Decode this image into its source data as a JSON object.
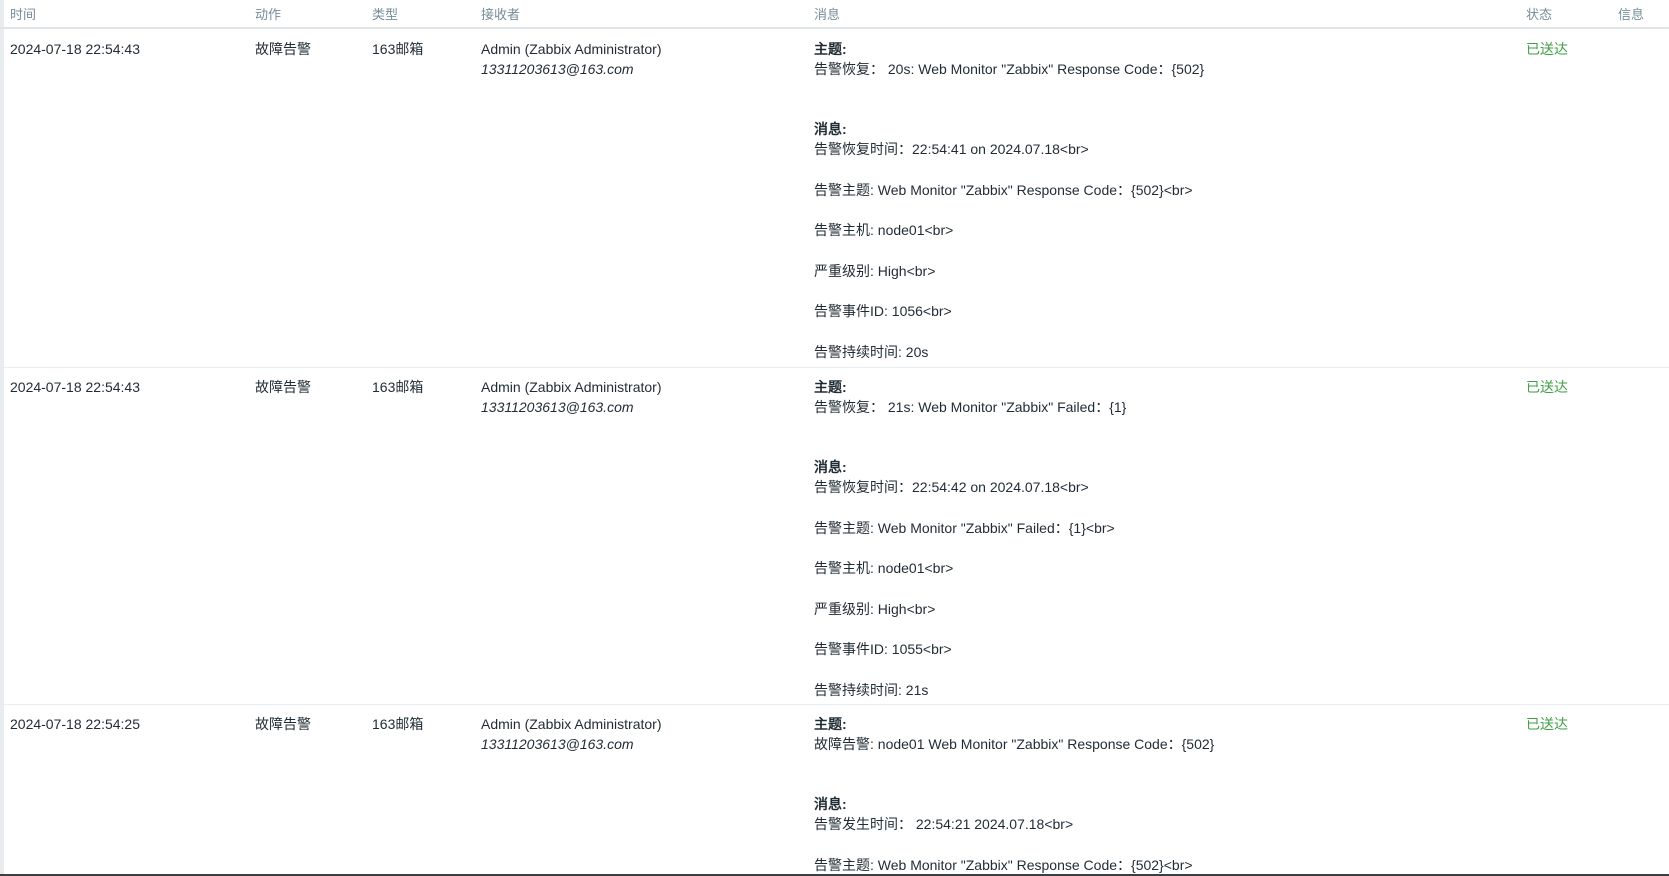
{
  "columns": {
    "time": "时间",
    "action": "动作",
    "type": "类型",
    "recipient": "接收者",
    "message": "消息",
    "status": "状态",
    "info": "信息"
  },
  "rows": [
    {
      "time": "2024-07-18 22:54:43",
      "action": "故障告警",
      "type": "163邮箱",
      "recipient_name": "Admin (Zabbix Administrator)",
      "recipient_email": "13311203613@163.com",
      "subject_heading": "主题:",
      "subject": "告警恢复： 20s: Web Monitor \"Zabbix\" Response Code：{502}",
      "message_heading": "消息:",
      "lines": [
        "告警恢复时间：22:54:41 on 2024.07.18<br>",
        "告警主题: Web Monitor \"Zabbix\" Response Code：{502}<br>",
        "告警主机: node01<br>",
        "严重级别: High<br>",
        "告警事件ID: 1056<br>",
        "告警持续时间: 20s"
      ],
      "status": "已送达"
    },
    {
      "time": "2024-07-18 22:54:43",
      "action": "故障告警",
      "type": "163邮箱",
      "recipient_name": "Admin (Zabbix Administrator)",
      "recipient_email": "13311203613@163.com",
      "subject_heading": "主题:",
      "subject": "告警恢复： 21s: Web Monitor \"Zabbix\" Failed：{1}",
      "message_heading": "消息:",
      "lines": [
        "告警恢复时间：22:54:42 on 2024.07.18<br>",
        "告警主题: Web Monitor \"Zabbix\" Failed：{1}<br>",
        "告警主机: node01<br>",
        "严重级别: High<br>",
        "告警事件ID: 1055<br>",
        "告警持续时间: 21s"
      ],
      "status": "已送达"
    },
    {
      "time": "2024-07-18 22:54:25",
      "action": "故障告警",
      "type": "163邮箱",
      "recipient_name": "Admin (Zabbix Administrator)",
      "recipient_email": "13311203613@163.com",
      "subject_heading": "主题:",
      "subject": "故障告警: node01 Web Monitor \"Zabbix\" Response Code：{502}",
      "message_heading": "消息:",
      "lines": [
        "告警发生时间： 22:54:21  2024.07.18<br>",
        "告警主题: Web Monitor \"Zabbix\" Response Code：{502}<br>"
      ],
      "status": "已送达"
    }
  ]
}
